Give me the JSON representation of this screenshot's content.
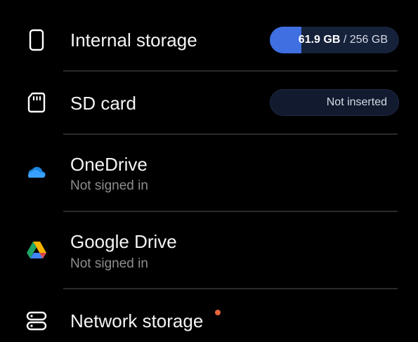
{
  "storage": {
    "internal": {
      "title": "Internal storage",
      "used": "61.9 GB",
      "separator": " / ",
      "total": "256 GB",
      "used_fraction": 0.242,
      "icon": "phone-icon"
    },
    "sd_card": {
      "title": "SD card",
      "status": "Not inserted",
      "icon": "sd-card-icon"
    },
    "onedrive": {
      "title": "OneDrive",
      "subtitle": "Not signed in",
      "icon": "onedrive-icon"
    },
    "google_drive": {
      "title": "Google Drive",
      "subtitle": "Not signed in",
      "icon": "google-drive-icon"
    },
    "network": {
      "title": "Network storage",
      "icon": "network-storage-icon",
      "badge_color": "#e8643c"
    }
  },
  "colors": {
    "background": "#000000",
    "accent": "#3f6fe0",
    "pill_track": "#16223a"
  }
}
